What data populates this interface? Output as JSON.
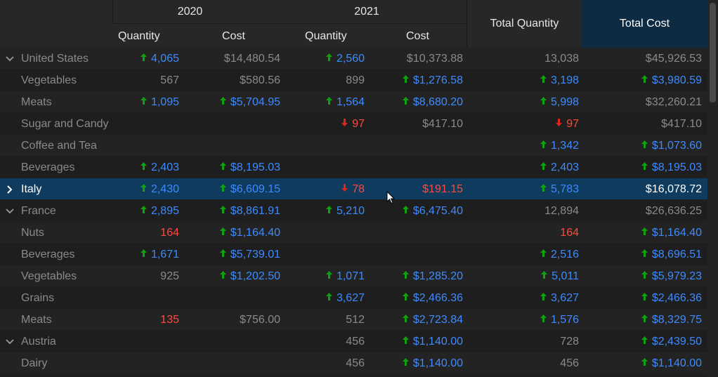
{
  "header": {
    "year_2020": "2020",
    "year_2021": "2021",
    "quantity_label": "Quantity",
    "cost_label": "Cost",
    "total_quantity": "Total Quantity",
    "total_cost": "Total Cost"
  },
  "colors": {
    "up_blue": "#3d8bff",
    "down_red": "#ff4a3d",
    "arrow_up_green": "#0fa20f",
    "arrow_down_red": "#e0241d",
    "selected_row": "#0e3b5e",
    "total_cost_header": "#0d2b43"
  },
  "rows": [
    {
      "label": "United States",
      "expander": "expanded",
      "selected": false,
      "cells": [
        {
          "text": "4,065",
          "trend": "up"
        },
        {
          "text": "$14,480.54",
          "trend": "none"
        },
        {
          "text": "2,560",
          "trend": "up"
        },
        {
          "text": "$10,373.88",
          "trend": "none"
        },
        {
          "text": "13,038",
          "trend": "none"
        },
        {
          "text": "$45,926.53",
          "trend": "none"
        }
      ]
    },
    {
      "label": "Vegetables",
      "expander": "",
      "selected": false,
      "cells": [
        {
          "text": "567",
          "trend": "none"
        },
        {
          "text": "$580.56",
          "trend": "none"
        },
        {
          "text": "899",
          "trend": "none"
        },
        {
          "text": "$1,276.58",
          "trend": "up"
        },
        {
          "text": "3,198",
          "trend": "up"
        },
        {
          "text": "$3,980.59",
          "trend": "up"
        }
      ]
    },
    {
      "label": "Meats",
      "expander": "",
      "selected": false,
      "cells": [
        {
          "text": "1,095",
          "trend": "up"
        },
        {
          "text": "$5,704.95",
          "trend": "up"
        },
        {
          "text": "1,564",
          "trend": "up"
        },
        {
          "text": "$8,680.20",
          "trend": "up"
        },
        {
          "text": "5,998",
          "trend": "up"
        },
        {
          "text": "$32,260.21",
          "trend": "none"
        }
      ]
    },
    {
      "label": "Sugar and Candy",
      "expander": "",
      "selected": false,
      "cells": [
        {
          "text": "",
          "trend": "none"
        },
        {
          "text": "",
          "trend": "none"
        },
        {
          "text": "97",
          "trend": "down"
        },
        {
          "text": "$417.10",
          "trend": "none"
        },
        {
          "text": "97",
          "trend": "down"
        },
        {
          "text": "$417.10",
          "trend": "none"
        }
      ]
    },
    {
      "label": "Coffee and Tea",
      "expander": "",
      "selected": false,
      "cells": [
        {
          "text": "",
          "trend": "none"
        },
        {
          "text": "",
          "trend": "none"
        },
        {
          "text": "",
          "trend": "none"
        },
        {
          "text": "",
          "trend": "none"
        },
        {
          "text": "1,342",
          "trend": "up"
        },
        {
          "text": "$1,073.60",
          "trend": "up"
        }
      ]
    },
    {
      "label": "Beverages",
      "expander": "",
      "selected": false,
      "cells": [
        {
          "text": "2,403",
          "trend": "up"
        },
        {
          "text": "$8,195.03",
          "trend": "up"
        },
        {
          "text": "",
          "trend": "none"
        },
        {
          "text": "",
          "trend": "none"
        },
        {
          "text": "2,403",
          "trend": "up"
        },
        {
          "text": "$8,195.03",
          "trend": "up"
        }
      ]
    },
    {
      "label": "Italy",
      "expander": "collapsed",
      "selected": true,
      "cells": [
        {
          "text": "2,430",
          "trend": "up"
        },
        {
          "text": "$6,609.15",
          "trend": "up"
        },
        {
          "text": "78",
          "trend": "down"
        },
        {
          "text": "$191.15",
          "trend": "down-noarrow"
        },
        {
          "text": "5,783",
          "trend": "up"
        },
        {
          "text": "$16,078.72",
          "trend": "bright"
        }
      ]
    },
    {
      "label": "France",
      "expander": "expanded",
      "selected": false,
      "cells": [
        {
          "text": "2,895",
          "trend": "up"
        },
        {
          "text": "$8,861.91",
          "trend": "up"
        },
        {
          "text": "5,210",
          "trend": "up"
        },
        {
          "text": "$6,475.40",
          "trend": "up"
        },
        {
          "text": "12,894",
          "trend": "none"
        },
        {
          "text": "$26,636.25",
          "trend": "none"
        }
      ]
    },
    {
      "label": "Nuts",
      "expander": "",
      "selected": false,
      "cells": [
        {
          "text": "164",
          "trend": "down-noarrow"
        },
        {
          "text": "$1,164.40",
          "trend": "up"
        },
        {
          "text": "",
          "trend": "none"
        },
        {
          "text": "",
          "trend": "none"
        },
        {
          "text": "164",
          "trend": "down-noarrow"
        },
        {
          "text": "$1,164.40",
          "trend": "up"
        }
      ]
    },
    {
      "label": "Beverages",
      "expander": "",
      "selected": false,
      "cells": [
        {
          "text": "1,671",
          "trend": "up"
        },
        {
          "text": "$5,739.01",
          "trend": "up"
        },
        {
          "text": "",
          "trend": "none"
        },
        {
          "text": "",
          "trend": "none"
        },
        {
          "text": "2,516",
          "trend": "up"
        },
        {
          "text": "$8,696.51",
          "trend": "up"
        }
      ]
    },
    {
      "label": "Vegetables",
      "expander": "",
      "selected": false,
      "cells": [
        {
          "text": "925",
          "trend": "none"
        },
        {
          "text": "$1,202.50",
          "trend": "up"
        },
        {
          "text": "1,071",
          "trend": "up"
        },
        {
          "text": "$1,285.20",
          "trend": "up"
        },
        {
          "text": "5,011",
          "trend": "up"
        },
        {
          "text": "$5,979.23",
          "trend": "up"
        }
      ]
    },
    {
      "label": "Grains",
      "expander": "",
      "selected": false,
      "cells": [
        {
          "text": "",
          "trend": "none"
        },
        {
          "text": "",
          "trend": "none"
        },
        {
          "text": "3,627",
          "trend": "up"
        },
        {
          "text": "$2,466.36",
          "trend": "up"
        },
        {
          "text": "3,627",
          "trend": "up"
        },
        {
          "text": "$2,466.36",
          "trend": "up"
        }
      ]
    },
    {
      "label": "Meats",
      "expander": "",
      "selected": false,
      "cells": [
        {
          "text": "135",
          "trend": "down-noarrow"
        },
        {
          "text": "$756.00",
          "trend": "none"
        },
        {
          "text": "512",
          "trend": "none"
        },
        {
          "text": "$2,723.84",
          "trend": "up"
        },
        {
          "text": "1,576",
          "trend": "up"
        },
        {
          "text": "$8,329.75",
          "trend": "up"
        }
      ]
    },
    {
      "label": "Austria",
      "expander": "expanded",
      "selected": false,
      "cells": [
        {
          "text": "",
          "trend": "none"
        },
        {
          "text": "",
          "trend": "none"
        },
        {
          "text": "456",
          "trend": "none"
        },
        {
          "text": "$1,140.00",
          "trend": "up"
        },
        {
          "text": "728",
          "trend": "none"
        },
        {
          "text": "$2,439.50",
          "trend": "up"
        }
      ]
    },
    {
      "label": "Dairy",
      "expander": "",
      "selected": false,
      "cells": [
        {
          "text": "",
          "trend": "none"
        },
        {
          "text": "",
          "trend": "none"
        },
        {
          "text": "456",
          "trend": "none"
        },
        {
          "text": "$1,140.00",
          "trend": "up"
        },
        {
          "text": "456",
          "trend": "none"
        },
        {
          "text": "$1,140.00",
          "trend": "up"
        }
      ]
    }
  ]
}
